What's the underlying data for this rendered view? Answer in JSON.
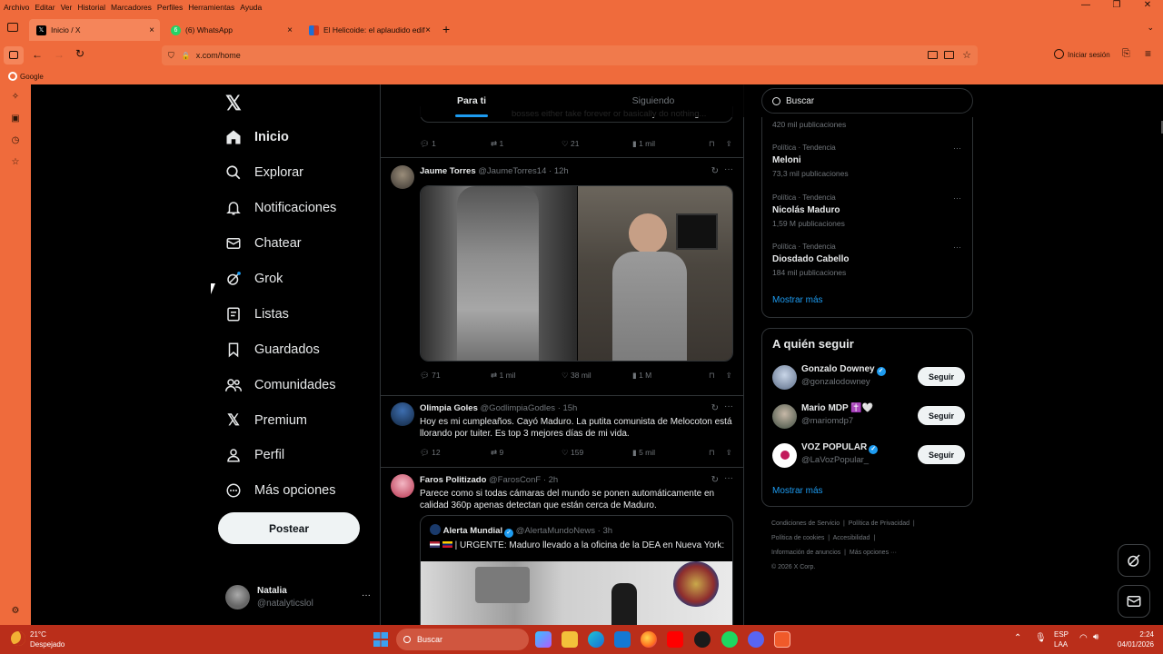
{
  "browser": {
    "menu": [
      "Archivo",
      "Editar",
      "Ver",
      "Historial",
      "Marcadores",
      "Perfiles",
      "Herramientas",
      "Ayuda"
    ],
    "tabs": [
      {
        "label": "Inicio / X"
      },
      {
        "label": "(6) WhatsApp"
      },
      {
        "label": "El Helicoide: el aplaudido edific"
      }
    ],
    "url": "x.com/home",
    "signin": "Iniciar sesión",
    "bookmark": "Google"
  },
  "nav": {
    "items": [
      "Inicio",
      "Explorar",
      "Notificaciones",
      "Chatear",
      "Grok",
      "Listas",
      "Guardados",
      "Comunidades",
      "Premium",
      "Perfil",
      "Más opciones"
    ],
    "post_label": "Postear",
    "user_name": "Natalia",
    "user_handle": "@natalyticslol"
  },
  "feed": {
    "tabs": [
      "Para ti",
      "Siguiendo"
    ],
    "top_partial": {
      "text": "bosses either take forever or basically do nothing...",
      "replies": "1",
      "reposts": "1",
      "likes": "21",
      "views": "1 mil"
    },
    "tweets": [
      {
        "name": "Jaume Torres",
        "handle": "@JaumeTorres14",
        "time": "· 12h",
        "text": "",
        "replies": "71",
        "reposts": "1 mil",
        "likes": "38 mil",
        "views": "1 M"
      },
      {
        "name": "Olimpia Goles",
        "handle": "@GodlimpiaGodles",
        "time": "· 15h",
        "text": "Hoy es mi cumpleaños. Cayó Maduro. La putita comunista de Melocoton está llorando por tuiter. Es top 3 mejores días de mi vida.",
        "replies": "12",
        "reposts": "9",
        "likes": "159",
        "views": "5 mil"
      },
      {
        "name": "Faros Politizado",
        "handle": "@FarosConF",
        "time": "· 2h",
        "text": "Parece como si todas cámaras del mundo se ponen automáticamente en calidad 360p apenas detectan que están cerca de Maduro."
      }
    ],
    "quote": {
      "name": "Alerta Mundial",
      "handle": "@AlertaMundoNews",
      "time": "· 3h",
      "text": "| URGENTE: Maduro llevado a la oficina de la DEA en Nueva York:"
    }
  },
  "right": {
    "search_placeholder": "Buscar",
    "trend_partial_count": "420 mil publicaciones",
    "trends": [
      {
        "category": "Política · Tendencia",
        "title": "Meloni",
        "count": "73,3 mil publicaciones"
      },
      {
        "category": "Política · Tendencia",
        "title": "Nicolás Maduro",
        "count": "1,59 M publicaciones"
      },
      {
        "category": "Política · Tendencia",
        "title": "Diosdado Cabello",
        "count": "184 mil publicaciones"
      }
    ],
    "show_more": "Mostrar más",
    "who_title": "A quién seguir",
    "follows": [
      {
        "name": "Gonzalo Downey",
        "handle": "@gonzalodowney",
        "button": "Seguir"
      },
      {
        "name": "Mario MDP ✝️🤍",
        "handle": "@mariomdp7",
        "button": "Seguir"
      },
      {
        "name": "VOZ POPULAR",
        "handle": "@LaVozPopular_",
        "button": "Seguir"
      }
    ],
    "show_more_2": "Mostrar más",
    "footer": [
      "Condiciones de Servicio",
      "Política de Privacidad",
      "Política de cookies",
      "Accesibilidad",
      "Información de anuncios",
      "Más opciones ···",
      "© 2026 X Corp."
    ]
  },
  "taskbar": {
    "temp": "21°C",
    "weather": "Despejado",
    "search": "Buscar",
    "lang1": "ESP",
    "lang2": "LAA",
    "time": "2:24",
    "date": "04/01/2026"
  },
  "colors": {
    "accent": "#1d9bf0",
    "browser": "#ef6b3c",
    "taskbar": "#ba2e1a"
  }
}
